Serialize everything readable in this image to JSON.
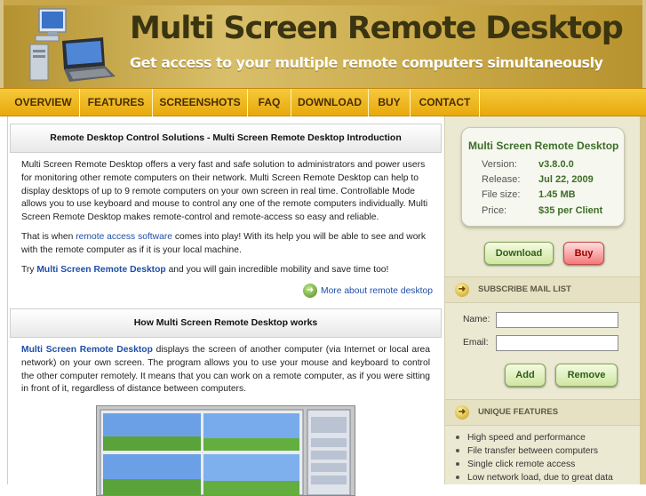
{
  "header": {
    "title": "Multi Screen Remote Desktop",
    "subtitle": "Get access to your multiple remote computers simultaneously",
    "logo_icon": "computers-icon"
  },
  "nav": [
    {
      "label": "OVERVIEW"
    },
    {
      "label": "FEATURES"
    },
    {
      "label": "SCREENSHOTS"
    },
    {
      "label": "FAQ"
    },
    {
      "label": "DOWNLOAD"
    },
    {
      "label": "BUY"
    },
    {
      "label": "CONTACT"
    }
  ],
  "intro": {
    "heading": "Remote Desktop Control Solutions - Multi Screen Remote Desktop Introduction",
    "p1": "Multi Screen Remote Desktop offers a very fast and safe solution to administrators and power users for monitoring other remote computers on their network. Multi Screen Remote Desktop can help to display desktops of up to 9 remote computers on your own screen in real time. Controllable Mode allows you to use keyboard and mouse to control any one of the remote computers individually. Multi Screen Remote Desktop makes remote-control and remote-access so easy and reliable.",
    "p2_before": "That is when ",
    "p2_link": "remote access software",
    "p2_after": " comes into play! With its help you will be able to see and work with the remote computer as if it is your local machine.",
    "p3_before": "Try ",
    "p3_link": "Multi Screen Remote Desktop",
    "p3_after": " and you will gain incredible mobility and save time too!",
    "more_link": "More about remote desktop"
  },
  "how": {
    "heading": "How Multi Screen Remote Desktop works",
    "p1_link": "Multi Screen Remote Desktop",
    "p1_after": " displays the screen of another computer (via Internet or local area network) on your own screen. The program allows you to use your mouse and keyboard to control the other computer remotely. It means that you can work on a remote computer, as if you were sitting in front of it, regardless of distance between computers."
  },
  "product": {
    "title": "Multi Screen Remote Desktop",
    "rows": [
      {
        "label": "Version:",
        "value": "v3.8.0.0"
      },
      {
        "label": "Release:",
        "value": "Jul 22, 2009"
      },
      {
        "label": "File size:",
        "value": "1.45 MB"
      },
      {
        "label": "Price:",
        "value": "$35 per Client"
      }
    ],
    "download_label": "Download",
    "buy_label": "Buy"
  },
  "mail": {
    "heading": "SUBSCRIBE MAIL LIST",
    "name_label": "Name:",
    "email_label": "Email:",
    "add_label": "Add",
    "remove_label": "Remove"
  },
  "features": {
    "heading": "UNIQUE FEATURES",
    "items": [
      "High speed and performance",
      "File transfer between computers",
      "Single click remote access",
      "Low network load, due to great data"
    ]
  },
  "colors": {
    "brand_gold": "#e7a90d",
    "accent_green": "#3d6e28",
    "link_blue": "#1f4ea8"
  }
}
